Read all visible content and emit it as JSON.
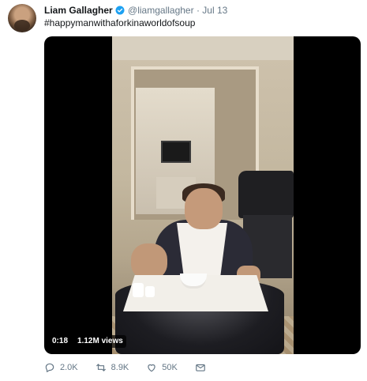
{
  "tweet": {
    "author": {
      "name": "Liam Gallagher",
      "handle": "@liamgallagher",
      "verified": true
    },
    "separator": "·",
    "date": "Jul 13",
    "text": "#happymanwithaforkinaworldofsoup",
    "media": {
      "type": "video",
      "time": "0:18",
      "views": "1.12M views"
    },
    "actions": {
      "reply": {
        "icon": "reply-icon",
        "count": "2.0K"
      },
      "retweet": {
        "icon": "retweet-icon",
        "count": "8.9K"
      },
      "like": {
        "icon": "heart-icon",
        "count": "50K"
      },
      "message": {
        "icon": "message-icon"
      }
    },
    "colors": {
      "name": "#14171a",
      "meta": "#657786",
      "verified": "#1da1f2",
      "media_bg": "#000000"
    }
  }
}
